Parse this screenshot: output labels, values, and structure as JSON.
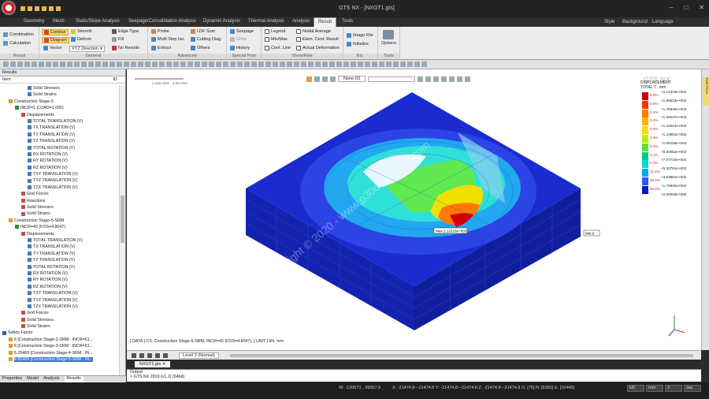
{
  "window": {
    "title": "GTS NX - [NXGT1.gts]"
  },
  "tabs": [
    "Geometry",
    "Mesh",
    "Static/Slope Analysis",
    "Seepage/Consolidation Analysis",
    "Dynamic Analysis",
    "Thermal Analysis",
    "Analysis",
    "Result",
    "Tools"
  ],
  "tabs_right": [
    "Style",
    "Background",
    "Language"
  ],
  "ribbon": {
    "groups": [
      {
        "caption": "Result",
        "items": [
          "Combination",
          "Calculation"
        ]
      },
      {
        "caption": "General",
        "items": [
          "Contour",
          "Diagram",
          "Vector",
          "Smooth",
          "Deform",
          "XYZ Direction",
          "Edge Type",
          "Fill",
          "No Results"
        ]
      },
      {
        "caption": "Advanced",
        "items": [
          "Probe",
          "Multi Step Iso.",
          "Extract",
          "LDF Sum",
          "Cutting Diag.",
          "Others"
        ]
      },
      {
        "caption": "Special Post",
        "items": [
          "Seepage",
          "Glide",
          "History"
        ]
      },
      {
        "caption": "Show/Hide",
        "items": [
          "Legend",
          "Min/Max",
          "Cont. Line",
          "Nodal Average",
          "Elem. Cent. Result",
          "Actual Deformation"
        ]
      },
      {
        "caption": "Etc.",
        "items": [
          "Image File",
          "Initialize"
        ]
      },
      {
        "caption": "Tools",
        "items": [
          "Options"
        ]
      }
    ]
  },
  "results_panel": {
    "header": "Results",
    "column": "Item",
    "id_col": "ID",
    "tree": [
      {
        "label": "Solid Stresses",
        "indent": 4
      },
      {
        "label": "Solid Strains",
        "indent": 4
      },
      {
        "label": "Construction Stage-5",
        "indent": 1
      },
      {
        "label": "INCR=1 (LOAD=1.000)",
        "indent": 2
      },
      {
        "label": "Displacements",
        "indent": 3
      },
      {
        "label": "TOTAL TRANSLATION (V)",
        "indent": 4
      },
      {
        "label": "TX TRANSLATION (V)",
        "indent": 4
      },
      {
        "label": "TY TRANSLATION (V)",
        "indent": 4
      },
      {
        "label": "TZ TRANSLATION (V)",
        "indent": 4
      },
      {
        "label": "TOTAL ROTATION (V)",
        "indent": 4
      },
      {
        "label": "RX ROTATION (V)",
        "indent": 4
      },
      {
        "label": "RY ROTATION (V)",
        "indent": 4
      },
      {
        "label": "RZ ROTATION (V)",
        "indent": 4
      },
      {
        "label": "TXY TRANSLATION (V)",
        "indent": 4
      },
      {
        "label": "TYZ TRANSLATION (V)",
        "indent": 4
      },
      {
        "label": "TZX TRANSLATION (V)",
        "indent": 4
      },
      {
        "label": "Grid Forces",
        "indent": 3
      },
      {
        "label": "Reactions",
        "indent": 3
      },
      {
        "label": "Solid Stresses",
        "indent": 3
      },
      {
        "label": "Solid Strains",
        "indent": 3
      },
      {
        "label": "Construction Stage-5-SRM",
        "indent": 1
      },
      {
        "label": "INCR=43 (FOS=4.8047)",
        "indent": 2
      },
      {
        "label": "Displacements",
        "indent": 3
      },
      {
        "label": "TOTAL TRANSLATION (V)",
        "indent": 4
      },
      {
        "label": "TX TRANSLATION (V)",
        "indent": 4
      },
      {
        "label": "TY TRANSLATION (V)",
        "indent": 4
      },
      {
        "label": "TZ TRANSLATION (V)",
        "indent": 4
      },
      {
        "label": "TOTAL ROTATION (V)",
        "indent": 4
      },
      {
        "label": "RX ROTATION (V)",
        "indent": 4
      },
      {
        "label": "RY ROTATION (V)",
        "indent": 4
      },
      {
        "label": "RZ ROTATION (V)",
        "indent": 4
      },
      {
        "label": "TXY TRANSLATION (V)",
        "indent": 4
      },
      {
        "label": "TYZ TRANSLATION (V)",
        "indent": 4
      },
      {
        "label": "TZX TRANSLATION (V)",
        "indent": 4
      },
      {
        "label": "Grid Forces",
        "indent": 3
      },
      {
        "label": "Solid Stresses",
        "indent": 3
      },
      {
        "label": "Solid Strains",
        "indent": 3
      },
      {
        "label": "Safety Factor",
        "indent": 0
      },
      {
        "label": "6 [Construction Stage-2-SRM : INCR=51...",
        "indent": 1
      },
      {
        "label": "6 [Construction Stage-3-SRM : INCR=51...",
        "indent": 1
      },
      {
        "label": "5.25469 [Construction Stage-4-SRM : IN...",
        "indent": 1
      },
      {
        "label": "4.80469 [Construction Stage-5-SRM : IN...",
        "indent": 1,
        "selected": true
      }
    ]
  },
  "bottom_tabs": [
    "Properties",
    "Model",
    "Analysis",
    "Results"
  ],
  "viewport": {
    "toolbar_combo": "None (0)",
    "ruler": [
      "1.44e+004",
      "2.9e+004"
    ],
    "max_label": "Max:2.12316e+003",
    "min_label": "Min:0",
    "watermark": "Copyright © 2020 - www.p30download.com",
    "info": "[ DATA ]  CS,  Construction Stage-5-SRM,  INCR=43 (FOS=4.8047),   [ UNIT ]   kN,  mm",
    "brand": "GTS NX"
  },
  "legend": {
    "title": "DISPLACEMENT",
    "subtitle": "TOTAL T , mm",
    "values": [
      "+2.12316e+003",
      "+1.96623e+003",
      "+1.76930e+003",
      "+1.59237e+003",
      "+1.41544e+003",
      "+1.23851e+003",
      "+1.06158e+003",
      "+8.84652e+002",
      "+7.07722e+002",
      "+5.30791e+002",
      "+3.53861e+002",
      "+1.76930e+002",
      "+0.00000e+000"
    ],
    "percents": [
      "0.0%",
      "0.0%",
      "0.2%",
      "0.4%",
      "0.6%",
      "1.6%",
      "2.4%",
      "4.1%",
      "5.3%",
      "11.4%",
      "18.5%",
      "55.5%"
    ],
    "colors": [
      "#d40000",
      "#ff3300",
      "#ff7b00",
      "#ffb400",
      "#f0e000",
      "#b8f000",
      "#5de030",
      "#00d080",
      "#00d8d0",
      "#00a8ff",
      "#2060ff",
      "#0018c8"
    ]
  },
  "playbar": {
    "level": "Level 3 (Normal)"
  },
  "file_tab": "NXGT1.gts",
  "output": {
    "title": "Output",
    "line": "> GTS NX 2019 (v1.2) (64bit)"
  },
  "status": {
    "w": "W: -130673, -39057.9",
    "coords": "X: -21474.8~-21474.8 Y: -21474.8~-21474.8 Z: -21474.8~-21474.8  G: [75]  N: [9355]  E: [16445]",
    "units": [
      "kN",
      "mm",
      "J",
      "sec"
    ]
  },
  "right_strip": "Task Pane"
}
